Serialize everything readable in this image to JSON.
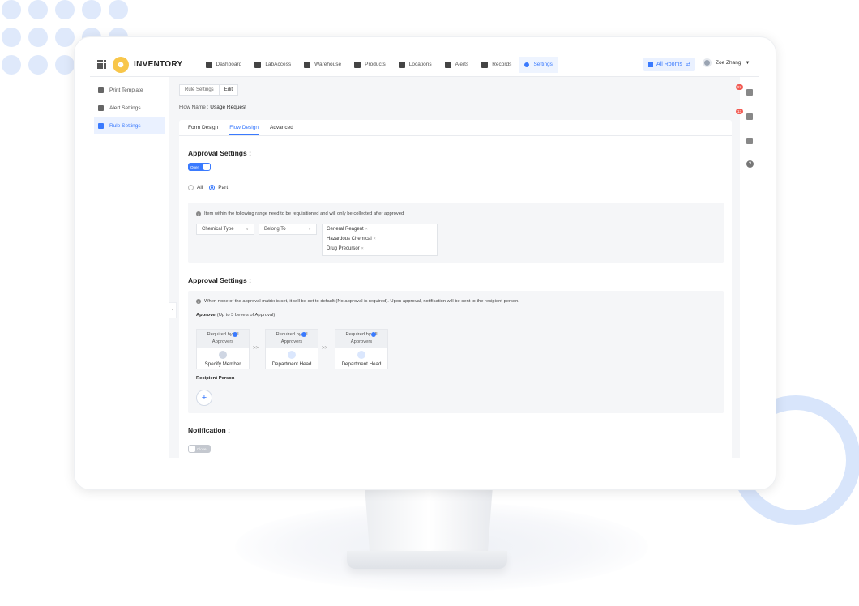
{
  "app": {
    "brand": "INVENTORY"
  },
  "nav": [
    {
      "label": "Dashboard",
      "icon": "dashboard-icon"
    },
    {
      "label": "LabAccess",
      "icon": "labaccess-icon"
    },
    {
      "label": "Warehouse",
      "icon": "warehouse-icon"
    },
    {
      "label": "Products",
      "icon": "products-icon"
    },
    {
      "label": "Locations",
      "icon": "locations-icon"
    },
    {
      "label": "Alerts",
      "icon": "alerts-icon"
    },
    {
      "label": "Records",
      "icon": "records-icon"
    },
    {
      "label": "Settings",
      "icon": "settings-icon",
      "active": true
    }
  ],
  "header": {
    "rooms": "All Rooms",
    "user": "Zoe Zhang"
  },
  "sidebar": {
    "items": [
      {
        "label": "Print Template"
      },
      {
        "label": "Alert Settings"
      },
      {
        "label": "Rule Settings",
        "active": true
      }
    ]
  },
  "breadcrumb": {
    "parent": "Rule Settings",
    "current": "Edit"
  },
  "flow": {
    "label": "Flow Name :",
    "value": "Usage Request"
  },
  "tabs": [
    "Form Design",
    "Flow Design",
    "Advanced"
  ],
  "approval1": {
    "title": "Approval Settings :",
    "toggle": "Open",
    "radio_all": "All",
    "radio_part": "Part",
    "info": "Item within the following range need to be requisitioned and will only be collected after approved",
    "select1": "Chemical Type",
    "select2": "Belong To",
    "tags": [
      "General Reagent",
      "Hazardous Chemical",
      "Drug Precursor"
    ]
  },
  "approval2": {
    "title": "Approval Settings :",
    "info": "When none of the approval matrix is set, it will be set to default (No approval is required). Upon approval, notification will be sent to the recipient person.",
    "approver_bold": "Approver",
    "approver_rest": "(Up to 3 Levels of Approval)",
    "cards": [
      {
        "head1": "Required by All",
        "head2": "Approvers",
        "label": "Specify Member"
      },
      {
        "head1": "Required by All",
        "head2": "Approvers",
        "label": "Department Head"
      },
      {
        "head1": "Required by All",
        "head2": "Approvers",
        "label": "Department Head"
      }
    ],
    "arrow": ">>",
    "recipient": "Recipient Person"
  },
  "notification": {
    "title": "Notification :",
    "toggle": "Close"
  },
  "rightbar": {
    "badge1": "97",
    "badge2": "13"
  },
  "colors": {
    "accent": "#3a7afe",
    "badge": "#f25c54"
  }
}
